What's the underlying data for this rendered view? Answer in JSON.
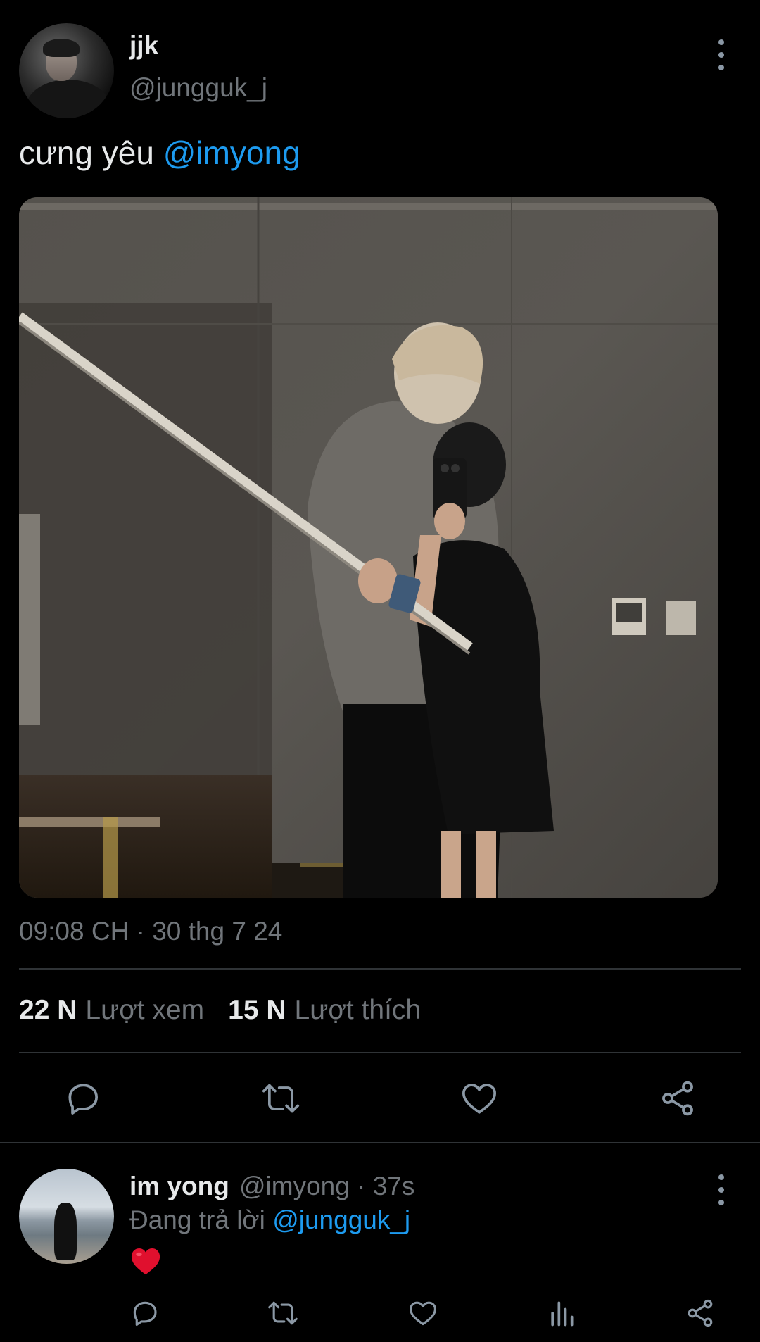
{
  "tweet": {
    "author_name": "jjk",
    "author_handle": "@jungguk_j",
    "text_prefix": "cưng yêu ",
    "mention": "@imyong",
    "timestamp": "09:08 CH · 30 thg 7 24",
    "stats": {
      "views_count": "22 N",
      "views_label": "Lượt xem",
      "likes_count": "15 N",
      "likes_label": "Lượt thích"
    }
  },
  "reply": {
    "author_name": "im yong",
    "handle_time": "@imyong · 37s",
    "replying_to_prefix": "Đang trả lời ",
    "replying_to_handle": "@jungguk_j",
    "text_emoji": "❤️"
  },
  "icons": {
    "more": "more-vertical-icon",
    "reply": "comment-icon",
    "retweet": "retweet-icon",
    "like": "heart-icon",
    "share": "share-icon",
    "analytics": "analytics-icon"
  },
  "colors": {
    "background": "#000000",
    "primary_text": "#e7e9ea",
    "secondary_text": "#71767b",
    "accent": "#1d9bf0",
    "divider": "#2f3336",
    "heart": "#e0102e"
  }
}
